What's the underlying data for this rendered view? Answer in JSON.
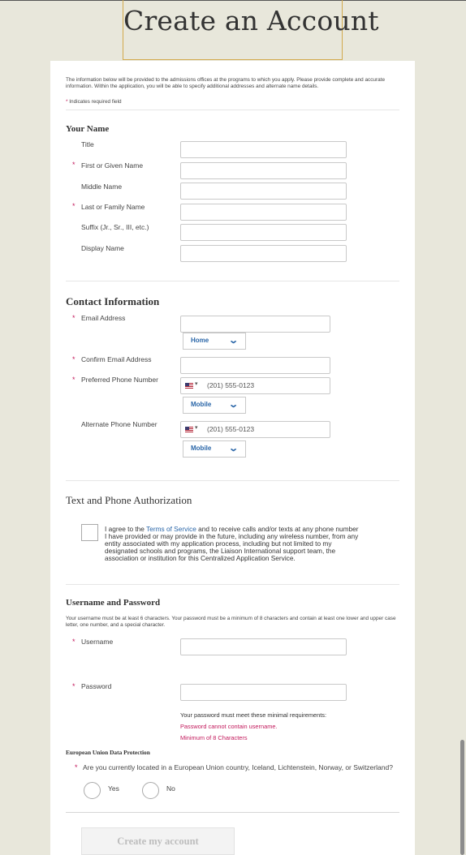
{
  "page": {
    "title": "Create an Account"
  },
  "intro": {
    "text": "The information below will be provided to the admissions offices at the programs to which you apply. Please provide complete and accurate information. Within the application, you will be able to specify additional addresses and alternate name details.",
    "required_star": "*",
    "required_note": "Indicates required field"
  },
  "your_name": {
    "heading": "Your Name",
    "fields": [
      {
        "label": "Title",
        "required": false,
        "value": ""
      },
      {
        "label": "First or Given Name",
        "required": true,
        "value": ""
      },
      {
        "label": "Middle Name",
        "required": false,
        "value": ""
      },
      {
        "label": "Last or Family Name",
        "required": true,
        "value": ""
      },
      {
        "label": "Suffix (Jr., Sr., III, etc.)",
        "required": false,
        "value": ""
      },
      {
        "label": "Display Name",
        "required": false,
        "value": ""
      }
    ]
  },
  "contact": {
    "heading": "Contact Information",
    "email_label": "Email Address",
    "email_value": "",
    "email_type": "Home",
    "confirm_email_label": "Confirm Email Address",
    "confirm_email_value": "",
    "preferred_phone_label": "Preferred Phone Number",
    "preferred_phone_placeholder": "(201) 555-0123",
    "preferred_phone_type": "Mobile",
    "alternate_phone_label": "Alternate Phone Number",
    "alternate_phone_placeholder": "(201) 555-0123",
    "alternate_phone_type": "Mobile",
    "flag_dropdown": "▾",
    "chevron": "⌄"
  },
  "authorization": {
    "heading": "Text and Phone Authorization",
    "consent_prefix": "I agree to the ",
    "consent_link": "Terms of Service",
    "consent_suffix": " and to receive calls and/or texts at any phone number I have provided or may provide in the future, including any wireless number, from any entity associated with my application process, including but not limited to my designated schools and programs, the Liaison International support team, the association or institution for this Centralized Application Service."
  },
  "credentials": {
    "heading": "Username and Password",
    "note": "Your username must be at least 6 characters. Your password must be a minimum of 8 characters and contain at least one lower and upper case letter, one number, and a special character.",
    "username_label": "Username",
    "username_value": "",
    "password_label": "Password",
    "password_value": "",
    "requirements_title": "Your password must meet these minimal requirements:",
    "requirements": [
      "Password cannot contain username.",
      "Minimum of 8 Characters"
    ]
  },
  "eu": {
    "heading": "European Union Data Protection",
    "question": "Are you currently located in a European Union country, Iceland, Lichtenstein, Norway, or Switzerland?",
    "yes": "Yes",
    "no": "No"
  },
  "submit": {
    "label": "Create my account"
  },
  "colors": {
    "background": "#e8e7db",
    "required": "#c2185b",
    "link": "#2a66a8",
    "title_border": "#d2a94c"
  }
}
